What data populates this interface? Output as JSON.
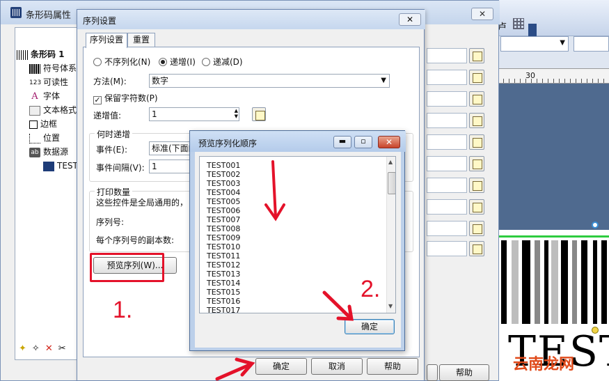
{
  "main_window": {
    "title": "条形码属性",
    "close_glyph": "✕",
    "tree": {
      "items": [
        {
          "label": "条形码 1",
          "icon": "barcode-icon"
        },
        {
          "label": "符号体系",
          "icon": "barcode-icon"
        },
        {
          "label": "可读性",
          "icon": "digits-icon",
          "icon_text": "123"
        },
        {
          "label": "字体",
          "icon": "font-icon",
          "icon_text": "A"
        },
        {
          "label": "文本格式",
          "icon": "text-format-icon"
        },
        {
          "label": "边框",
          "icon": "border-icon"
        },
        {
          "label": "位置",
          "icon": "position-icon"
        },
        {
          "label": "数据源",
          "icon": "datasource-icon",
          "icon_text": "ab"
        },
        {
          "label": "TEST",
          "icon": "datasource-item-icon"
        }
      ]
    },
    "bottom_buttons": {
      "ok": "确定",
      "cancel": "取消",
      "help": "帮助",
      "help_right": "帮助"
    }
  },
  "dialog": {
    "title": "序列设置",
    "close_glyph": "✕",
    "tabs": [
      {
        "label": "序列设置"
      },
      {
        "label": "重置"
      }
    ],
    "mode": {
      "options": [
        {
          "label": "不序列化(N)",
          "selected": false
        },
        {
          "label": "递增(I)",
          "selected": true
        },
        {
          "label": "递减(D)",
          "selected": false
        }
      ]
    },
    "method_label": "方法(M):",
    "method_value": "数字",
    "keep_chars_label": "保留字符数(P)",
    "keep_chars_checked": true,
    "step_label": "递增值:",
    "step_value": "1",
    "when_group_title": "何时递增",
    "event_label": "事件(E):",
    "event_value": "标准(下面的",
    "event_interval_label": "事件间隔(V):",
    "event_interval_value": "1",
    "print_group_title": "打印数量",
    "print_note": "这些控件是全局通用的，",
    "serial_label": "序列号:",
    "copies_label": "每个序列号的副本数:",
    "preview_button": "预览序列(W)..."
  },
  "preview": {
    "title": "预览序列化顺序",
    "items": [
      "TEST001",
      "TEST002",
      "TEST003",
      "TEST004",
      "TEST005",
      "TEST006",
      "TEST007",
      "TEST008",
      "TEST009",
      "TEST010",
      "TEST011",
      "TEST012",
      "TEST013",
      "TEST014",
      "TEST015",
      "TEST016",
      "TEST017"
    ],
    "ok_button": "确定",
    "min_glyph": "▬",
    "max_glyph": "▫",
    "close_glyph": "✕"
  },
  "annotations": {
    "step1": "1.",
    "step2": "2."
  },
  "background_app": {
    "ruler_label": "30",
    "canvas_text": "TEST",
    "watermark": "云南龙网"
  },
  "colors": {
    "annotation_red": "#e4122a",
    "title_blue": "#c6d7ee"
  }
}
